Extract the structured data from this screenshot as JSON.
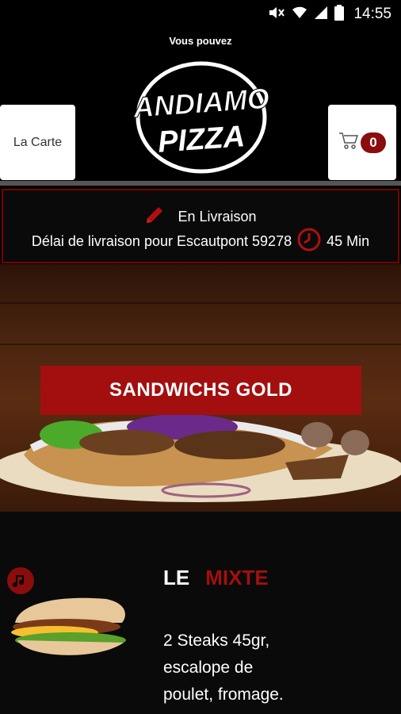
{
  "status_bar": {
    "time": "14:55",
    "icons": [
      "mute-icon",
      "wifi-icon",
      "signal-icon",
      "battery-icon"
    ]
  },
  "header": {
    "tagline": "Vous pouvez",
    "logo": {
      "line1": "ANDIAMO",
      "line2": "PIZZA"
    },
    "menu_button_label": "La Carte",
    "cart_count": "0"
  },
  "delivery": {
    "mode": "En Livraison",
    "delay_text": "Délai de livraison pour Escautpont 59278",
    "time": "45 Min"
  },
  "category": {
    "title": "SANDWICHS GOLD"
  },
  "product": {
    "name_part1": "LE",
    "name_part2": "MIXTE",
    "description": "2 Steaks 45gr, escalope de poulet, fromage."
  },
  "colors": {
    "accent_red": "#a30f0f",
    "dark_red": "#7a0000",
    "background": "#000000",
    "white": "#ffffff"
  }
}
